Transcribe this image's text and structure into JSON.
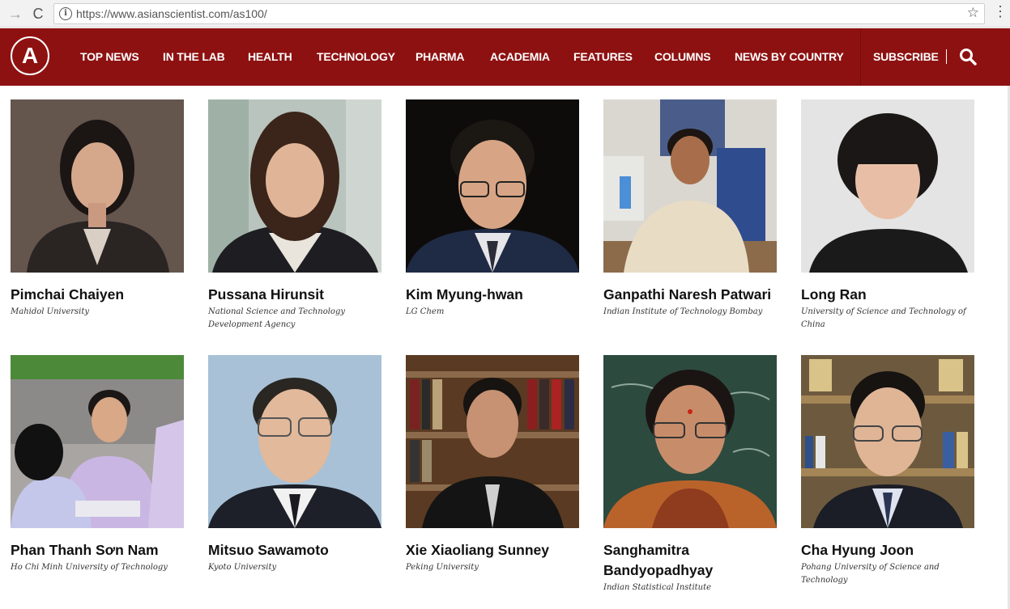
{
  "browser": {
    "url": "https://www.asianscientist.com/as100/",
    "back_icon": "→",
    "reload_icon": "C",
    "info_icon": "i",
    "star_icon": "☆",
    "menu_icon": "⋮"
  },
  "site": {
    "logo_letter": "A",
    "brand_color": "#8e1111",
    "menu": [
      "TOP NEWS",
      "IN THE LAB",
      "HEALTH",
      "TECHNOLOGY",
      "PHARMA",
      "ACADEMIA",
      "FEATURES",
      "COLUMNS",
      "NEWS BY COUNTRY"
    ],
    "subscribe_label": "SUBSCRIBE"
  },
  "people": [
    {
      "name": "Pimchai Chaiyen",
      "affiliation": "Mahidol University"
    },
    {
      "name": "Pussana Hirunsit",
      "affiliation": "National Science and Technology Development Agency"
    },
    {
      "name": "Kim Myung-hwan",
      "affiliation": "LG Chem"
    },
    {
      "name": "Ganpathi Naresh Patwari",
      "affiliation": "Indian Institute of Technology Bombay"
    },
    {
      "name": "Long Ran",
      "affiliation": "University of Science and Technology of China"
    },
    {
      "name": "Phan Thanh Sơn Nam",
      "affiliation": "Ho Chi Minh University of Technology"
    },
    {
      "name": "Mitsuo Sawamoto",
      "affiliation": "Kyoto University"
    },
    {
      "name": "Xie Xiaoliang Sunney",
      "affiliation": "Peking University"
    },
    {
      "name": "Sanghamitra Bandyopadhyay",
      "affiliation": "Indian Statistical Institute"
    },
    {
      "name": "Cha Hyung Joon",
      "affiliation": "Pohang University of Science and Technology"
    }
  ]
}
